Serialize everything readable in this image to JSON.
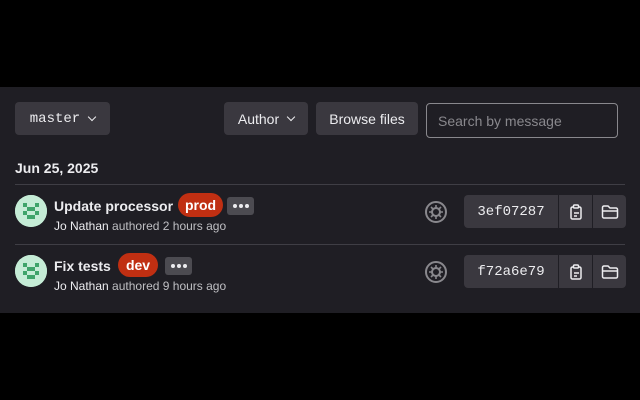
{
  "toolbar": {
    "branch": "master",
    "author_label": "Author",
    "browse_label": "Browse files",
    "search_placeholder": "Search by message"
  },
  "date_header": "Jun 25, 2025",
  "commits": [
    {
      "title": "Update processor",
      "tag": "prod",
      "author": "Jo Nathan",
      "authored_text": "authored",
      "time": "2 hours ago",
      "sha": "3ef07287"
    },
    {
      "title": "Fix tests",
      "tag": "dev",
      "author": "Jo Nathan",
      "authored_text": "authored",
      "time": "9 hours ago",
      "sha": "f72a6e79"
    }
  ],
  "colors": {
    "background": "#1f1e24",
    "button": "#3a383f",
    "tag": "#c02f12",
    "avatar": "#c5ecd6"
  },
  "icons": [
    "chevron-down-icon",
    "ellipsis-icon",
    "pipeline-status-icon",
    "copy-icon",
    "folder-icon",
    "avatar-identicon"
  ]
}
